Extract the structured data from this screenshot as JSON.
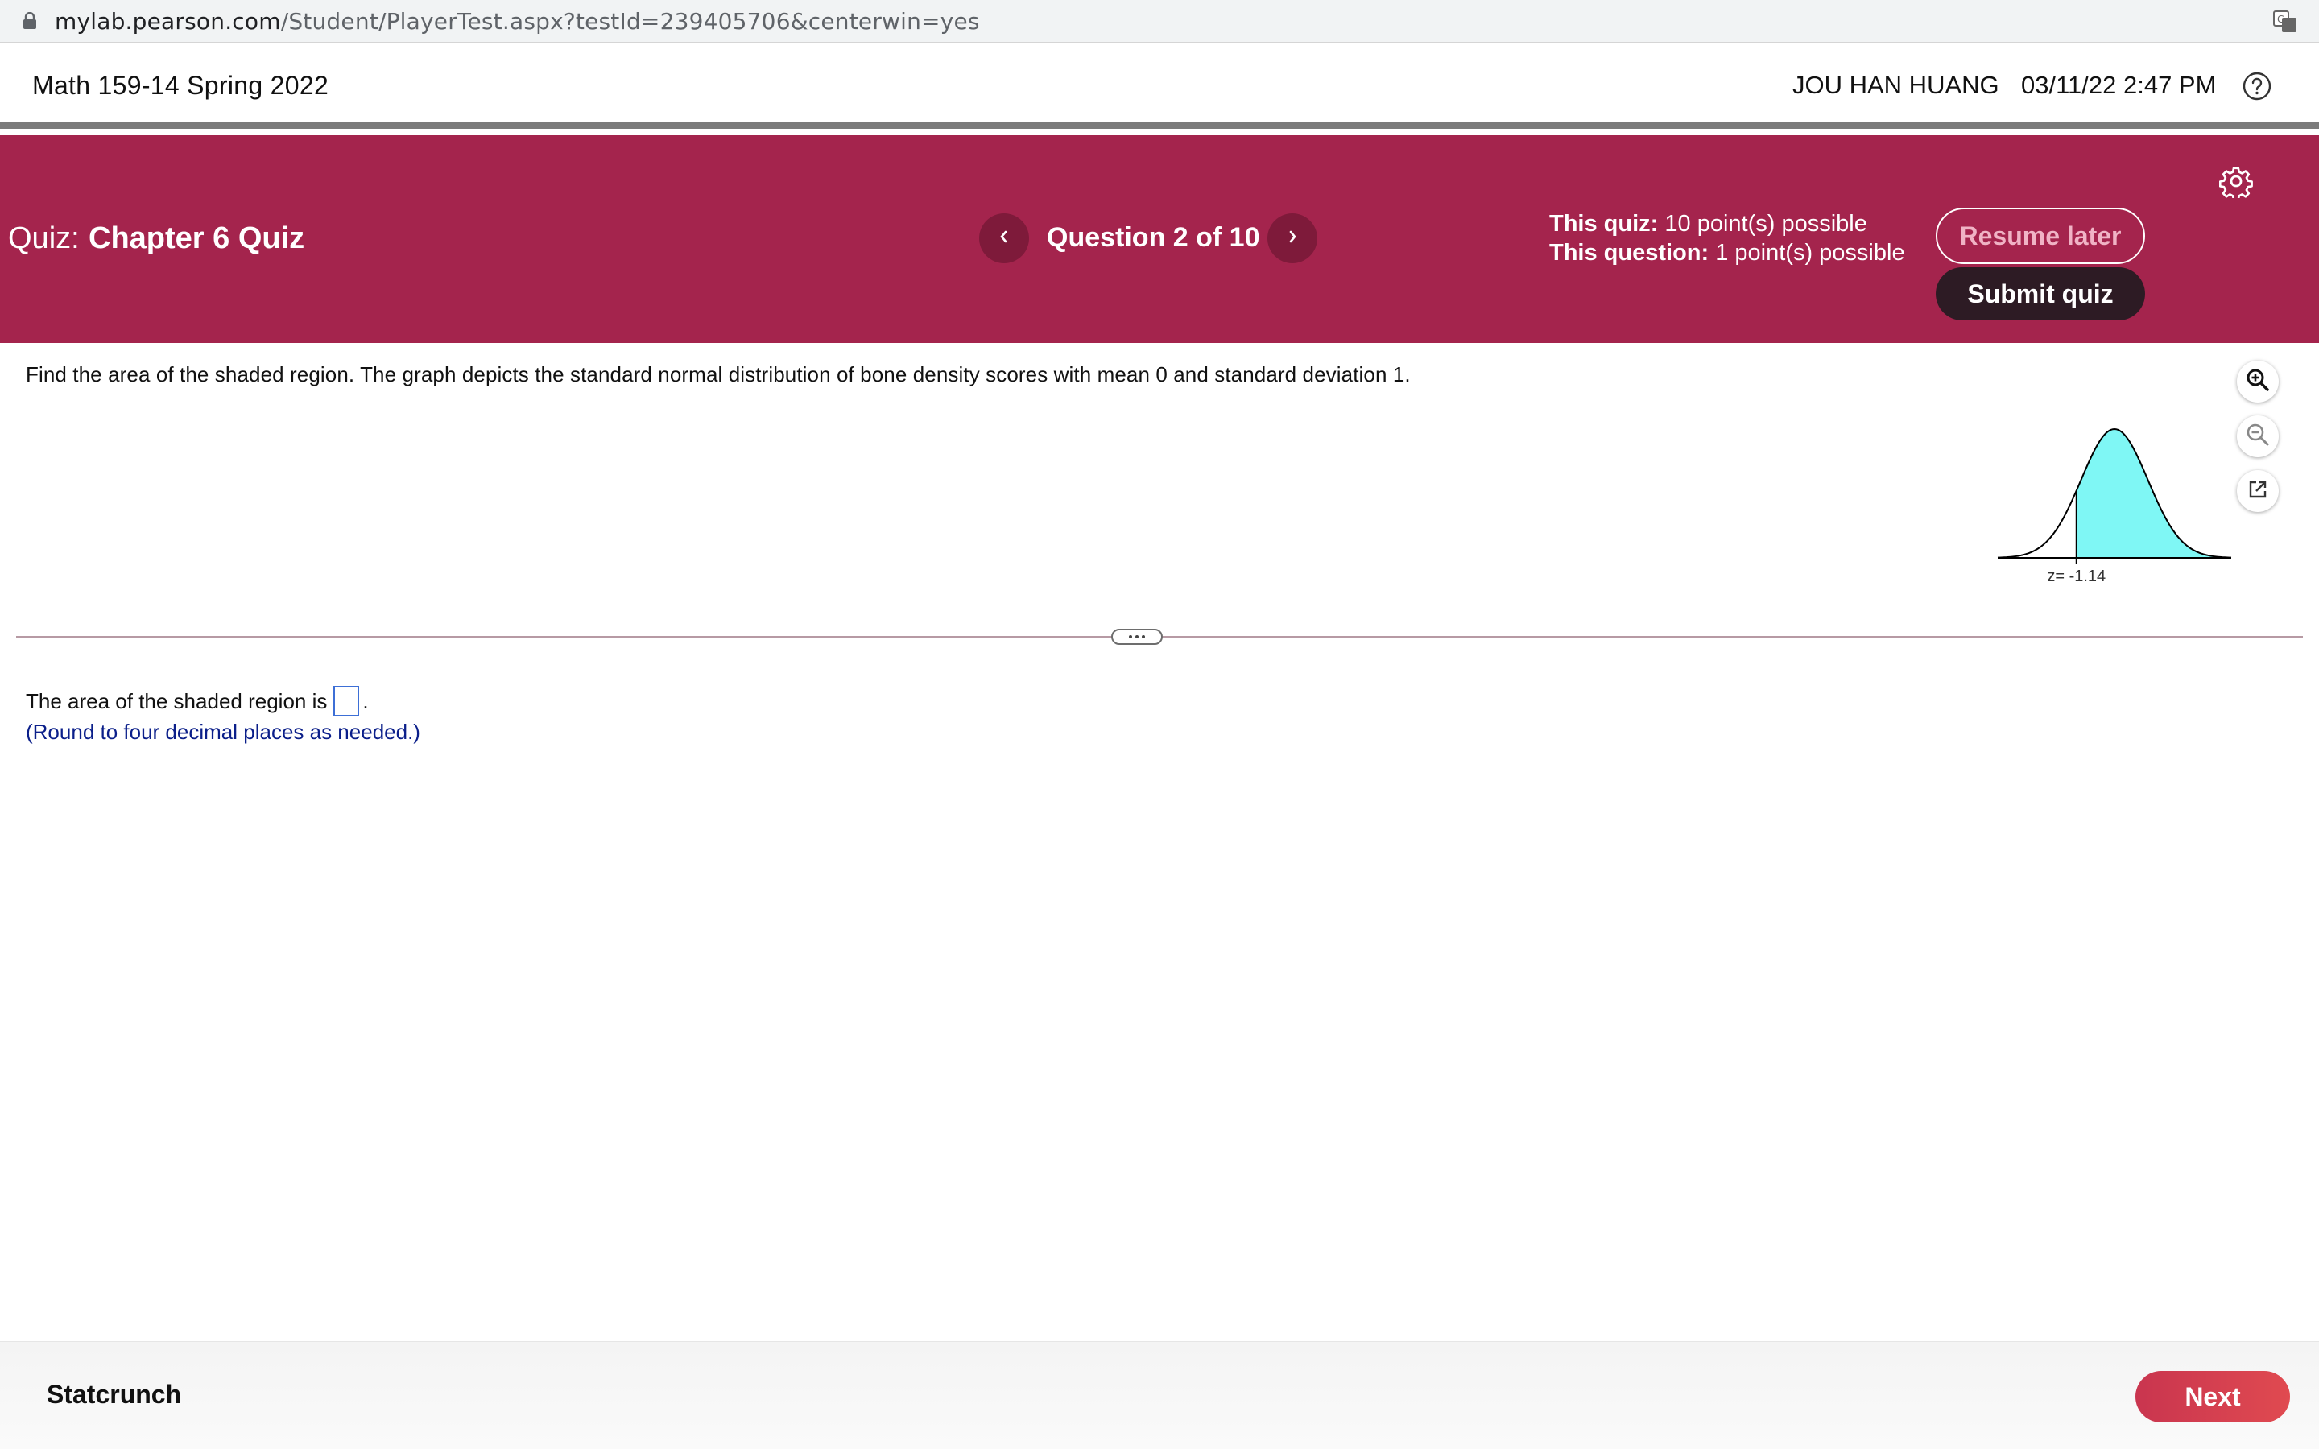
{
  "browser": {
    "url_host": "mylab.pearson.com",
    "url_path": "/Student/PlayerTest.aspx?testId=239405706&centerwin=yes",
    "icons": [
      "lock-icon",
      "translate-icon"
    ]
  },
  "header": {
    "course_title": "Math 159-14 Spring 2022",
    "user_name": "JOU HAN HUANG",
    "datetime": "03/11/22 2:47 PM",
    "help_icon": "help-icon"
  },
  "quiz_bar": {
    "label": "Quiz:",
    "name": "Chapter 6 Quiz",
    "question_counter": "Question 2 of 10",
    "quiz_points_label": "This quiz:",
    "quiz_points_value": "10 point(s) possible",
    "question_points_label": "This question:",
    "question_points_value": "1 point(s) possible",
    "resume_label": "Resume later",
    "submit_label": "Submit quiz",
    "background_color": "#a4244d"
  },
  "question": {
    "prompt": "Find the area of the shaded region. The graph depicts the standard normal distribution of bone density scores with mean 0 and standard deviation 1.",
    "graph": {
      "z_label": "z= -1.14",
      "z_value": -1.14,
      "shading_color": "#7ff7f5"
    },
    "answer_prefix": "The area of the shaded region is",
    "answer_value": "",
    "answer_suffix": ".",
    "hint": "(Round to four decimal places as needed.)"
  },
  "footer": {
    "statcrunch_label": "Statcrunch",
    "next_label": "Next"
  }
}
